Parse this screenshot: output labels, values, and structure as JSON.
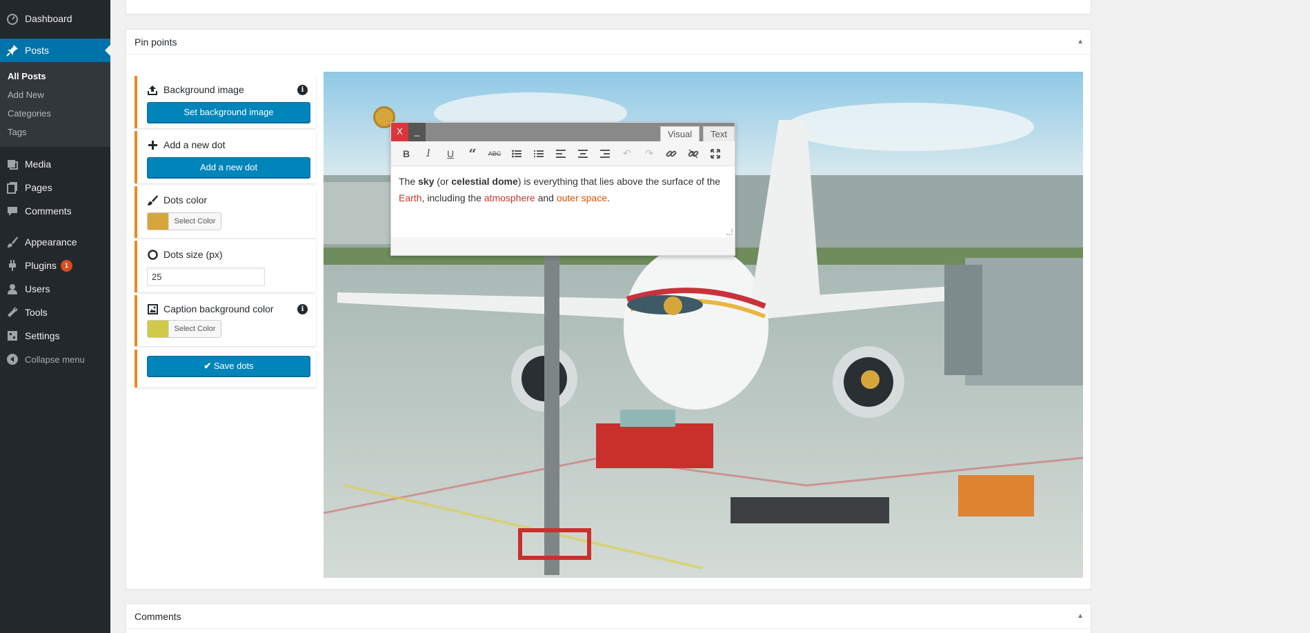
{
  "sidebar": {
    "items": [
      {
        "label": "Dashboard",
        "icon": "dashboard-icon"
      },
      {
        "label": "Posts",
        "icon": "pushpin-icon"
      },
      {
        "label": "Media",
        "icon": "media-icon"
      },
      {
        "label": "Pages",
        "icon": "pages-icon"
      },
      {
        "label": "Comments",
        "icon": "comments-icon"
      },
      {
        "label": "Appearance",
        "icon": "paintbrush-icon"
      },
      {
        "label": "Plugins",
        "icon": "plugins-icon",
        "badge": "1"
      },
      {
        "label": "Users",
        "icon": "users-icon"
      },
      {
        "label": "Tools",
        "icon": "wrench-icon"
      },
      {
        "label": "Settings",
        "icon": "settings-icon"
      },
      {
        "label": "Collapse menu",
        "icon": "collapse-icon"
      }
    ],
    "submenu": [
      "All Posts",
      "Add New",
      "Categories",
      "Tags"
    ]
  },
  "postboxes": {
    "pinpoints_title": "Pin points",
    "comments_title": "Comments"
  },
  "panel": {
    "background_label": "Background image",
    "background_button": "Set background image",
    "dot_label": "Add a new dot",
    "dot_button": "Add a new dot",
    "dots_color_label": "Dots color",
    "select_color": "Select Color",
    "dots_color": "#d6a63d",
    "dots_size_label": "Dots size (px)",
    "dots_size_value": "25",
    "caption_bg_label": "Caption background color",
    "caption_bg_color": "#d1c94a",
    "save_button": "Save dots"
  },
  "editor": {
    "close_label": "X",
    "minimize_label": "_",
    "tab_visual": "Visual",
    "tab_text": "Text",
    "content": {
      "p1": "The ",
      "sky": "sky",
      "p2": " (or ",
      "celestial": "celestial dome",
      "p3": ") is everything that lies above the surface of the ",
      "earth": "Earth",
      "p4": ", including the ",
      "atmosphere": "atmosphere",
      "p5": " and ",
      "outer_space": "outer space",
      "p6": "."
    }
  },
  "colors": {
    "accent": "#0073aa",
    "button": "#0085ba",
    "panel_border": "#ee8a1f",
    "dot": "#d6a63d",
    "close_button": "#d9363e"
  }
}
